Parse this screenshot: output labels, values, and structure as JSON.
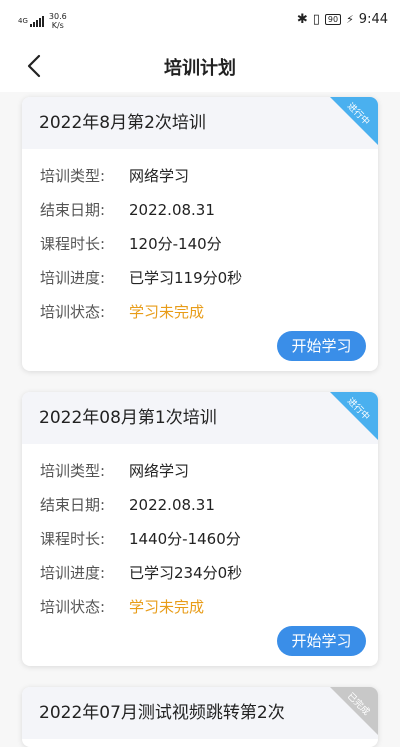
{
  "status_bar": {
    "network": "4G",
    "speed_value": "30.6",
    "speed_unit": "K/s",
    "battery": "90",
    "time": "9:44"
  },
  "header": {
    "title": "培训计划"
  },
  "labels": {
    "type": "培训类型:",
    "end_date": "结束日期:",
    "duration": "课程时长:",
    "progress": "培训进度:",
    "status": "培训状态:"
  },
  "cards": [
    {
      "title": "2022年8月第2次培训",
      "ribbon": "进行中",
      "type": "网络学习",
      "end_date": "2022.08.31",
      "duration": "120分-140分",
      "progress": "已学习119分0秒",
      "status": "学习未完成",
      "button": "开始学习"
    },
    {
      "title": "2022年08月第1次培训",
      "ribbon": "进行中",
      "type": "网络学习",
      "end_date": "2022.08.31",
      "duration": "1440分-1460分",
      "progress": "已学习234分0秒",
      "status": "学习未完成",
      "button": "开始学习"
    },
    {
      "title": "2022年07月测试视频跳转第2次",
      "ribbon": "已完成"
    }
  ],
  "colors": {
    "accent": "#3a8ee8",
    "ribbon_active": "#4ab0ef",
    "ribbon_done": "#c8c8c8",
    "status_warn": "#e89c18"
  }
}
